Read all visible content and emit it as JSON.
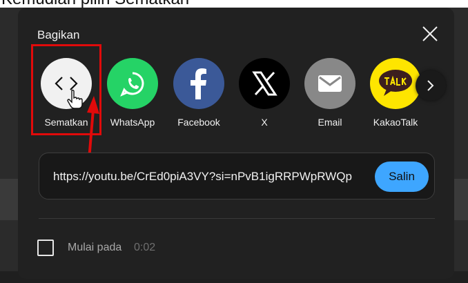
{
  "caption": "Kemudian pilih Sematkan",
  "dialog": {
    "title": "Bagikan",
    "share_targets": [
      {
        "label": "Sematkan",
        "icon": "embed-code-icon",
        "color": "#f1f1f1"
      },
      {
        "label": "WhatsApp",
        "icon": "whatsapp-icon",
        "color": "#25d366"
      },
      {
        "label": "Facebook",
        "icon": "facebook-icon",
        "color": "#3b5998"
      },
      {
        "label": "X",
        "icon": "x-logo-icon",
        "color": "#000000"
      },
      {
        "label": "Email",
        "icon": "email-icon",
        "color": "#888888"
      },
      {
        "label": "KakaoTalk",
        "icon": "kakaotalk-icon",
        "color": "#fee500"
      }
    ],
    "url": "https://youtu.be/CrEd0piA3VY?si=nPvB1igRRPWpRWQp",
    "copy_label": "Salin",
    "start_at_label": "Mulai pada",
    "start_at_time": "0:02"
  },
  "colors": {
    "dialog_bg": "#212121",
    "accent": "#3ea6ff",
    "highlight": "#e10a0a"
  }
}
